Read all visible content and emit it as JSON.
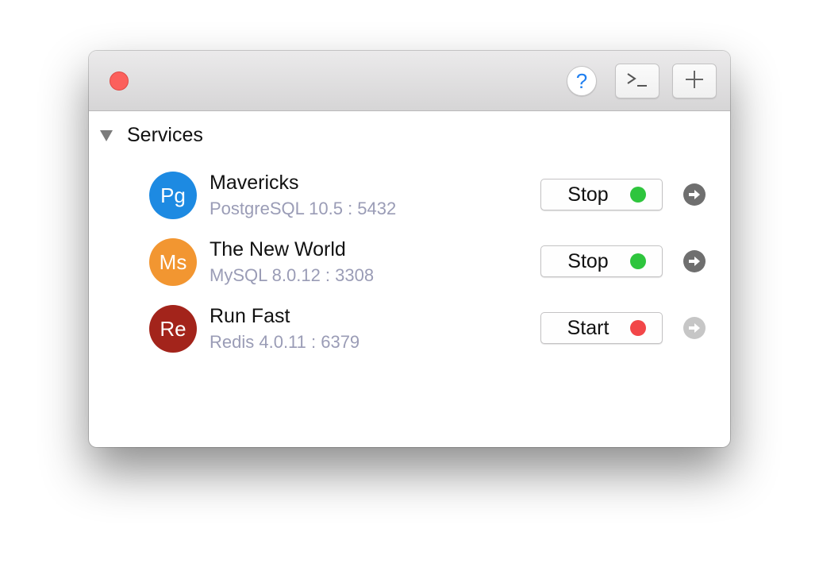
{
  "titlebar": {
    "help_label": "?",
    "terminal_icon": "terminal-icon",
    "add_icon": "plus-icon"
  },
  "section": {
    "title": "Services"
  },
  "services": [
    {
      "abbr": "Pg",
      "name": "Mavericks",
      "detail": "PostgreSQL 10.5 : 5432",
      "action": "Stop",
      "status": "running",
      "avatar_color": "#1d8ae2",
      "status_color": "#2ec53d",
      "arrow_color": "#6f6f6f"
    },
    {
      "abbr": "Ms",
      "name": "The New World",
      "detail": "MySQL 8.0.12 : 3308",
      "action": "Stop",
      "status": "running",
      "avatar_color": "#f29631",
      "status_color": "#2ec53d",
      "arrow_color": "#6f6f6f"
    },
    {
      "abbr": "Re",
      "name": "Run Fast",
      "detail": "Redis 4.0.11 : 6379",
      "action": "Start",
      "status": "stopped",
      "avatar_color": "#a3241b",
      "status_color": "#f24648",
      "arrow_color": "#c6c6c6"
    }
  ],
  "colors": {
    "close": "#fc605c",
    "help_accent": "#1f7ff0",
    "detail_text": "#9a9cb6"
  }
}
